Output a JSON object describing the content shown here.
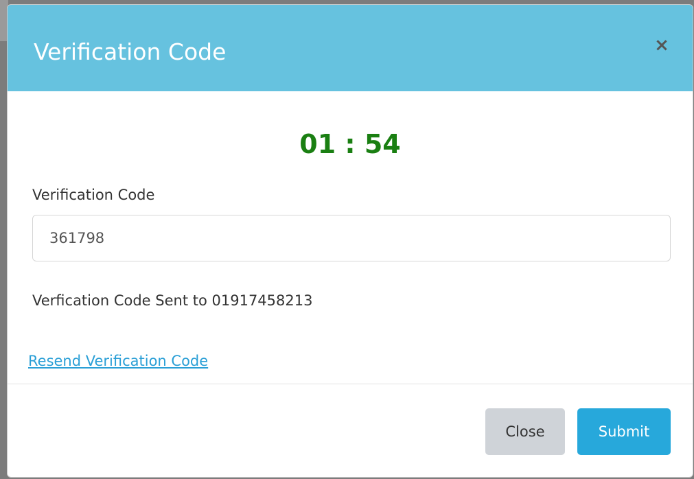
{
  "modal": {
    "title": "Verification Code",
    "close_symbol": "×",
    "timer": "01 : 54",
    "field_label": "Verification Code",
    "code_value": "361798",
    "sent_message": "Verfication Code Sent to 01917458213",
    "resend_label": "Resend Verification Code",
    "close_button": "Close",
    "submit_button": "Submit"
  },
  "colors": {
    "header": "#66c2df",
    "timer": "#1a7f12",
    "link": "#2a9fd6",
    "submit": "#27a8db",
    "close_button": "#cfd3d8"
  },
  "icons": {
    "close": "close-icon"
  }
}
